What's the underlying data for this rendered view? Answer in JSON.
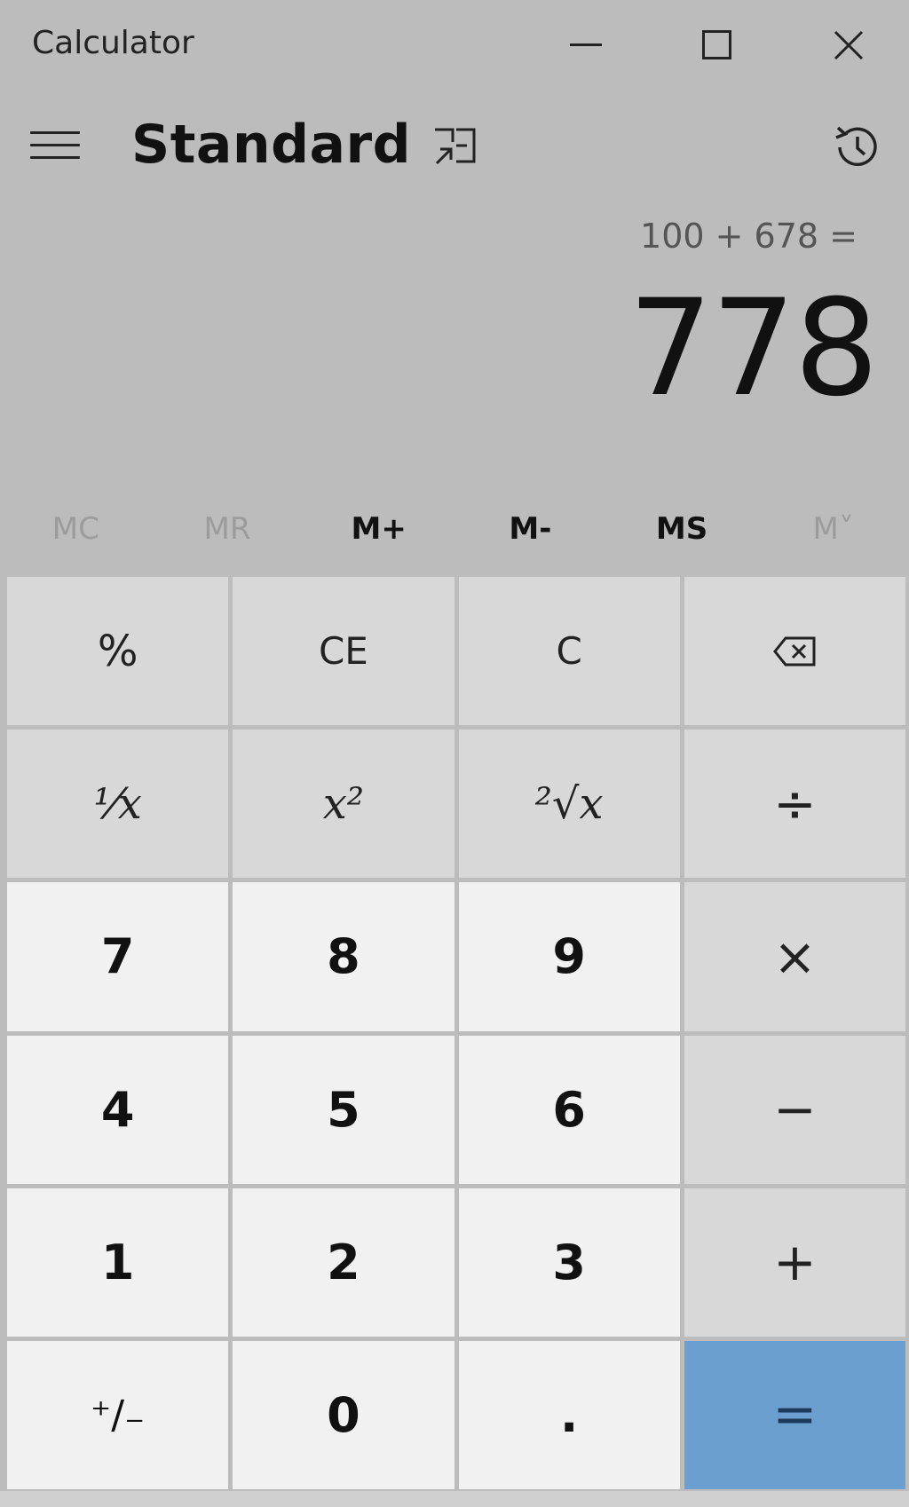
{
  "window": {
    "title": "Calculator"
  },
  "header": {
    "mode_title": "Standard"
  },
  "display": {
    "expression": "100 + 678 =",
    "result": "778"
  },
  "memory": {
    "items": [
      "MC",
      "MR",
      "M+",
      "M-",
      "MS",
      "M˅"
    ]
  },
  "keys": {
    "percent": "%",
    "ce": "CE",
    "c": "C",
    "reciprocal": "⅟x",
    "square": "x²",
    "sqrt": "²√x",
    "divide": "÷",
    "seven": "7",
    "eight": "8",
    "nine": "9",
    "multiply": "×",
    "four": "4",
    "five": "5",
    "six": "6",
    "minus": "−",
    "one": "1",
    "two": "2",
    "three": "3",
    "plus": "+",
    "negate": "⁺∕₋",
    "zero": "0",
    "decimal": ".",
    "equals": "="
  },
  "colors": {
    "background": "#bcbcbc",
    "function_key": "#d8d8d8",
    "number_key": "#f1f1f1",
    "equals_key": "#6a9fcf"
  },
  "icons": {
    "minimize": "minimize-icon",
    "maximize": "maximize-icon",
    "close": "close-icon",
    "menu": "hamburger-icon",
    "keep_on_top": "keep-on-top-icon",
    "history": "history-icon",
    "backspace": "backspace-icon"
  }
}
